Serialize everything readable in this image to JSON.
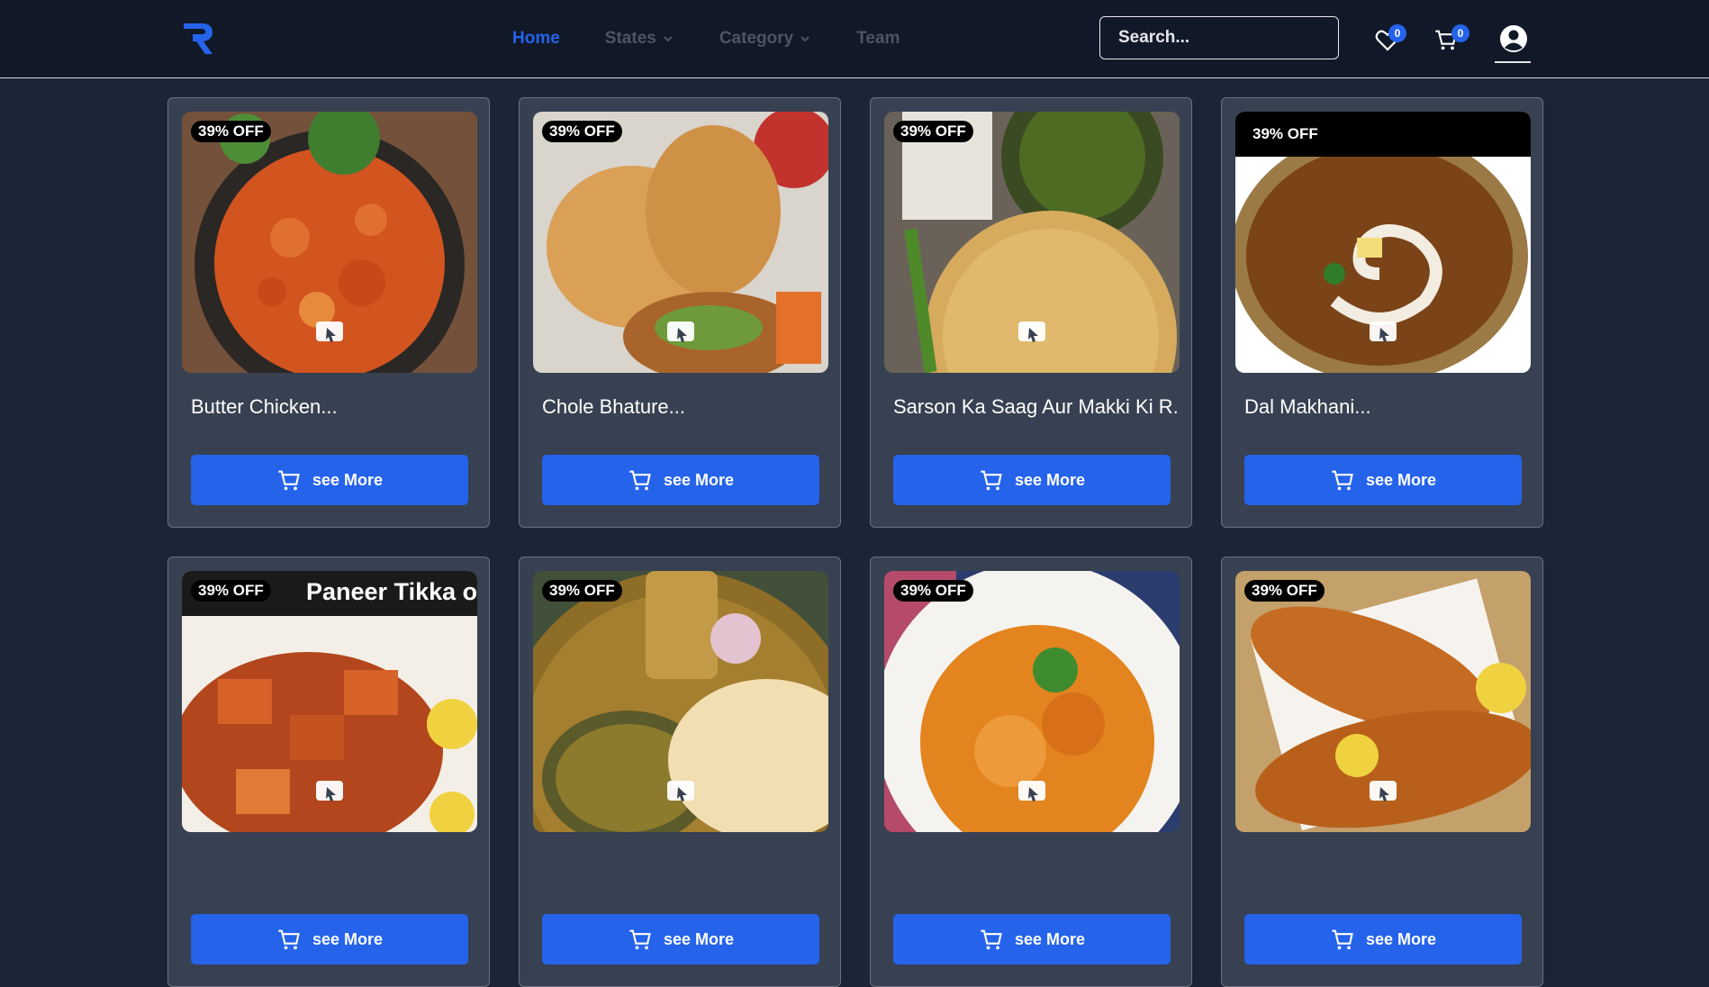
{
  "nav": {
    "links": [
      {
        "label": "Home",
        "active": true,
        "dropdown": false
      },
      {
        "label": "States",
        "active": false,
        "dropdown": true
      },
      {
        "label": "Category",
        "active": false,
        "dropdown": true
      },
      {
        "label": "Team",
        "active": false,
        "dropdown": false
      }
    ],
    "search_placeholder": "Search...",
    "wishlist_count": "0",
    "cart_count": "0"
  },
  "colors": {
    "accent": "#2563eb",
    "nav_bg": "#111827",
    "page_bg": "#1c2536",
    "card_bg": "#374151"
  },
  "products": [
    {
      "title": "Butter Chicken...",
      "discount": "39% OFF",
      "button": "see More",
      "image": "butter-chicken"
    },
    {
      "title": "Chole Bhature...",
      "discount": "39% OFF",
      "button": "see More",
      "image": "chole-bhature"
    },
    {
      "title": "Sarson Ka Saag Aur Makki Ki R...",
      "discount": "39% OFF",
      "button": "see More",
      "image": "sarson-saag"
    },
    {
      "title": "Dal Makhani...",
      "discount": "39% OFF",
      "button": "see More",
      "image": "dal-makhani"
    },
    {
      "title": "",
      "discount": "39% OFF",
      "button": "see More",
      "image": "paneer-tikka",
      "image_caption": "Paneer Tikka on Tawa"
    },
    {
      "title": "",
      "discount": "39% OFF",
      "button": "see More",
      "image": "amritsari-kulcha"
    },
    {
      "title": "",
      "discount": "39% OFF",
      "button": "see More",
      "image": "chicken-curry"
    },
    {
      "title": "",
      "discount": "39% OFF",
      "button": "see More",
      "image": "fried-fish"
    }
  ]
}
